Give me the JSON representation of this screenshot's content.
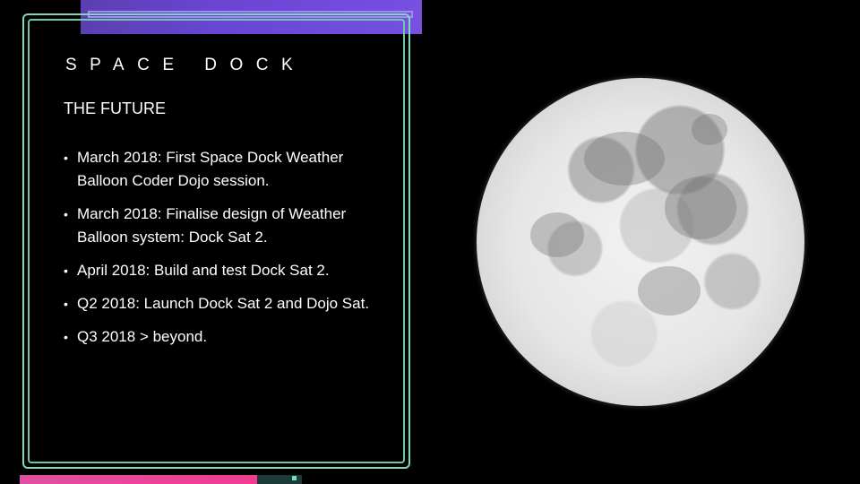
{
  "brand": "SPACE DOCK",
  "section_title": "THE FUTURE",
  "bullets": [
    "March 2018: First Space Dock Weather Balloon Coder Dojo session.",
    "March 2018: Finalise design of Weather Balloon system: Dock Sat 2.",
    "April 2018: Build and test Dock Sat 2.",
    "Q2 2018: Launch Dock Sat 2 and Dojo Sat.",
    "Q3 2018 > beyond."
  ],
  "bullet_symbol": "•",
  "colors": {
    "background": "#000000",
    "frame": "#7fd8b8",
    "top_bar": "#6a45d4",
    "bottom_bar": "#f03c90"
  },
  "image": "moon-image"
}
